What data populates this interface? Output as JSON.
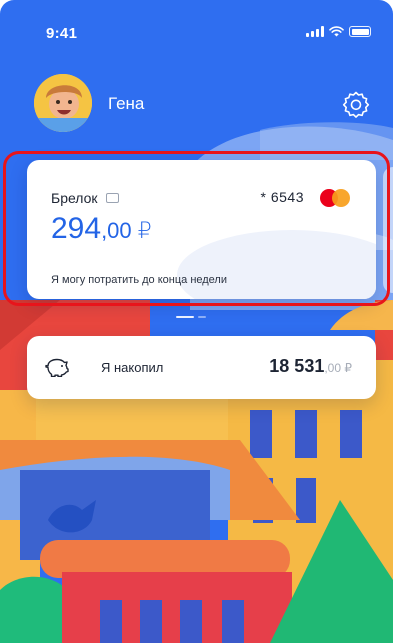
{
  "status_bar": {
    "time": "9:41"
  },
  "header": {
    "user_name": "Гена"
  },
  "main_card": {
    "title": "Брелок",
    "card_number": "* 6543",
    "balance_integer": "294",
    "balance_fraction": ",00 ₽",
    "caption": "Я могу потратить до конца недели"
  },
  "savings": {
    "label": "Я накопил",
    "amount_integer": "18 531",
    "amount_fraction": ",00 ₽"
  },
  "colors": {
    "background": "#2f6ef0",
    "accent": "#2364e6",
    "highlight": "#e8141b",
    "mastercard_red": "#eb001b",
    "mastercard_orange": "#f79e1b"
  },
  "icons": [
    "signal-icon",
    "wifi-icon",
    "battery-icon",
    "settings-gear-icon",
    "card-icon",
    "mastercard-icon",
    "piggy-bank-icon"
  ]
}
